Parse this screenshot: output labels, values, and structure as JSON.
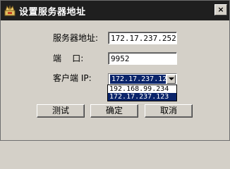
{
  "window": {
    "title": "设置服务器地址",
    "close_glyph": "×"
  },
  "form": {
    "server_address_label": "服务器地址:",
    "server_address_value": "172.17.237.252",
    "port_label": "端    口:",
    "port_value": "9952",
    "client_ip_label": "客户端 IP:",
    "client_ip_selected": "172.17.237.123",
    "client_ip_options": [
      "192.168.99.234",
      "172.17.237.123"
    ],
    "client_ip_highlighted_option": "172.17.237.123"
  },
  "buttons": {
    "test": "测试",
    "ok": "确定",
    "cancel": "取消"
  },
  "colors": {
    "selection": "#0a246a",
    "titlebar": "#1f1f1f",
    "face": "#d4d0c8"
  }
}
